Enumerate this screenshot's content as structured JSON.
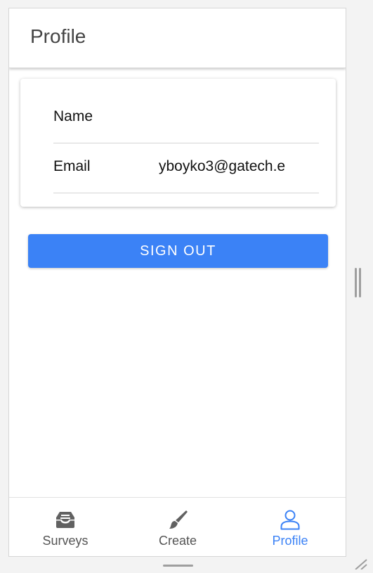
{
  "header": {
    "title": "Profile"
  },
  "profile_card": {
    "fields": [
      {
        "label": "Name",
        "value": ""
      },
      {
        "label": "Email",
        "value": "yboyko3@gatech.e"
      }
    ]
  },
  "actions": {
    "sign_out_label": "SIGN OUT"
  },
  "bottom_nav": {
    "items": [
      {
        "label": "Surveys",
        "icon": "inbox-tray-icon",
        "active": false
      },
      {
        "label": "Create",
        "icon": "paintbrush-icon",
        "active": false
      },
      {
        "label": "Profile",
        "icon": "person-icon",
        "active": true
      }
    ]
  },
  "colors": {
    "accent": "#3b82f6",
    "nav_inactive": "#555555",
    "icon_inactive": "#616161",
    "background": "#f3f3f3"
  }
}
